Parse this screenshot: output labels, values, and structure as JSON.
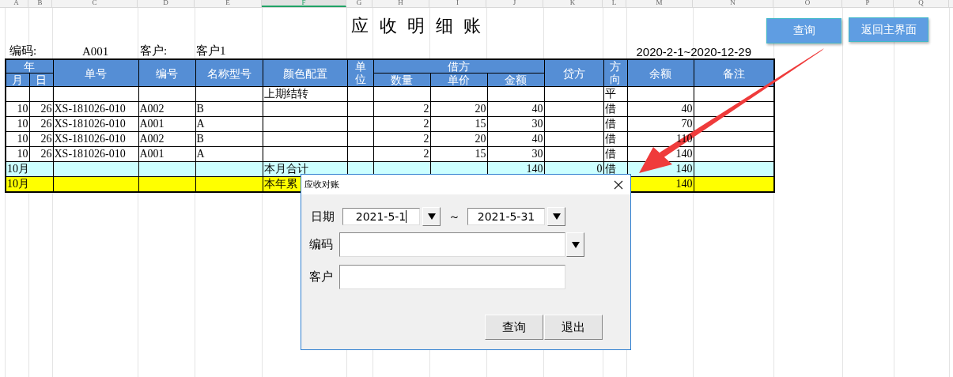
{
  "sheet": {
    "columns": [
      {
        "label": "A",
        "selected": false
      },
      {
        "label": "B",
        "selected": false
      },
      {
        "label": "C",
        "selected": false
      },
      {
        "label": "D",
        "selected": false
      },
      {
        "label": "E",
        "selected": false
      },
      {
        "label": "F",
        "selected": true
      },
      {
        "label": "G",
        "selected": false
      },
      {
        "label": "H",
        "selected": false
      },
      {
        "label": "I",
        "selected": false
      },
      {
        "label": "J",
        "selected": false
      },
      {
        "label": "K",
        "selected": false
      },
      {
        "label": "L",
        "selected": false
      },
      {
        "label": "M",
        "selected": false
      },
      {
        "label": "N",
        "selected": false
      },
      {
        "label": "O",
        "selected": false
      },
      {
        "label": "P",
        "selected": false
      },
      {
        "label": "Q",
        "selected": false
      }
    ],
    "title": "应 收 明 细 账",
    "info": {
      "code_label": "编码:",
      "code": "A001",
      "customer_label": "客户:",
      "customer": "客户1",
      "period": "2020-2-1~2020-12-29"
    },
    "table": {
      "header": [
        {
          "text": "年",
          "children": [
            {
              "text": "月"
            },
            {
              "text": "日"
            }
          ]
        },
        {
          "text": "单号"
        },
        {
          "text": "编号"
        },
        {
          "text": "名称型号"
        },
        {
          "text": "颜色配置"
        },
        {
          "text": "单位",
          "vertical": true
        },
        {
          "text": "借方",
          "children": [
            {
              "text": "数量"
            },
            {
              "text": "单价"
            },
            {
              "text": "金额"
            }
          ]
        },
        {
          "text": "贷方"
        },
        {
          "text": "方向",
          "vertical": true
        },
        {
          "text": "余额"
        },
        {
          "text": "备注"
        }
      ],
      "rows": [
        {
          "kind": "opening",
          "cells": {
            "f": "上期结转",
            "l": "平"
          }
        },
        {
          "kind": "item",
          "cells": {
            "a": "10",
            "b": "26",
            "c": "XS-181026-010",
            "d": "A002",
            "e": "B",
            "h": "2",
            "i": "20",
            "j": "40",
            "l": "借",
            "m": "40"
          }
        },
        {
          "kind": "item",
          "cells": {
            "a": "10",
            "b": "26",
            "c": "XS-181026-010",
            "d": "A001",
            "e": "A",
            "h": "2",
            "i": "15",
            "j": "30",
            "l": "借",
            "m": "70"
          }
        },
        {
          "kind": "item",
          "cells": {
            "a": "10",
            "b": "26",
            "c": "XS-181026-010",
            "d": "A002",
            "e": "B",
            "h": "2",
            "i": "20",
            "j": "40",
            "l": "借",
            "m": "110"
          }
        },
        {
          "kind": "item",
          "cells": {
            "a": "10",
            "b": "26",
            "c": "XS-181026-010",
            "d": "A001",
            "e": "A",
            "h": "2",
            "i": "15",
            "j": "30",
            "l": "借",
            "m": "140"
          }
        },
        {
          "kind": "month_total",
          "cells": {
            "a": "10月",
            "f": "本月合计",
            "j": "140",
            "k": "0",
            "l": "借",
            "m": "140"
          }
        },
        {
          "kind": "year_total",
          "cells": {
            "a": "10月",
            "f": "本年累",
            "m": "140"
          }
        }
      ]
    }
  },
  "toolbar_buttons": [
    "查询",
    "返回主界面"
  ],
  "dialog": {
    "title": "应收对账",
    "date_label": "日期",
    "date_from": {
      "value": "2021-5-1",
      "focused": true
    },
    "separator": "～",
    "date_to": {
      "value": "2021-5-31",
      "focused": false
    },
    "code_label": "编码",
    "customer_label": "客户",
    "buttons": [
      "查询",
      "退出"
    ]
  }
}
